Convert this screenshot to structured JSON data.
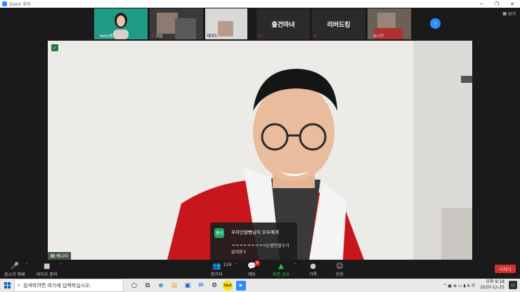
{
  "window": {
    "title": "Zoom 회의",
    "minimize": "─",
    "maximize": "❐",
    "close": "✕"
  },
  "gallery": {
    "tiles": [
      {
        "name": "Kelly쌤",
        "muted": true
      },
      {
        "name": "고남",
        "muted": true
      },
      {
        "name": "재태트",
        "muted": false
      },
      {
        "name": "출건마녀",
        "muted": true
      },
      {
        "name": "리버드킹",
        "muted": true
      },
      {
        "name": "소니구",
        "muted": true
      }
    ],
    "next_icon": "chevron-right-icon",
    "next_glyph": "›",
    "view_label": "보기",
    "view_icon": "grid-icon",
    "view_glyph": "▦"
  },
  "main_video": {
    "speaker_name": "쿼니아",
    "shield_glyph": "✓"
  },
  "chat_popup": {
    "avatar": "용대",
    "from": "부자단발뻥님이 모두에게",
    "message": "ㅋㅋㅋㅋㅋㅋㅋㅋㅋ눈찡만할수가 없네용ㅎ"
  },
  "toolbar": {
    "unmute": {
      "label": "음소거 해제",
      "glyph": "🎤"
    },
    "video": {
      "label": "비디오 중지",
      "glyph": "■"
    },
    "participants": {
      "label": "참가자",
      "count": "229",
      "glyph": "👥"
    },
    "chat": {
      "label": "채팅",
      "badge": "4",
      "glyph": "💬"
    },
    "share": {
      "label": "화면 공유",
      "glyph": "▲"
    },
    "record": {
      "label": "기록",
      "glyph": "●"
    },
    "reactions": {
      "label": "반응",
      "glyph": "☺"
    },
    "caret": "^",
    "leave": "나가기",
    "colors": {
      "share": "#23c552",
      "leave": "#d32f2f",
      "mute": "#e22222"
    }
  },
  "taskbar": {
    "search_placeholder": "검색하려면 여기에 입력하십시오.",
    "search_glyph": "⌕",
    "apps": [
      {
        "icon": "cortana-icon",
        "glyph": "○"
      },
      {
        "icon": "task-view-icon",
        "glyph": "⧉"
      },
      {
        "icon": "edge-icon",
        "glyph": "e"
      },
      {
        "icon": "file-explorer-icon",
        "glyph": "▤"
      },
      {
        "icon": "store-icon",
        "glyph": "▣"
      },
      {
        "icon": "mail-icon",
        "glyph": "✉"
      },
      {
        "icon": "settings-icon",
        "glyph": "⚙"
      },
      {
        "icon": "kakaotalk-icon",
        "glyph": "TALK"
      },
      {
        "icon": "zoom-icon",
        "glyph": "▶"
      }
    ],
    "tray_glyphs": "^ ▣ ⊕ ▭ ◖ A 가",
    "time": "오후 9:18",
    "date": "2020-12-25",
    "notif_glyph": "▭"
  }
}
